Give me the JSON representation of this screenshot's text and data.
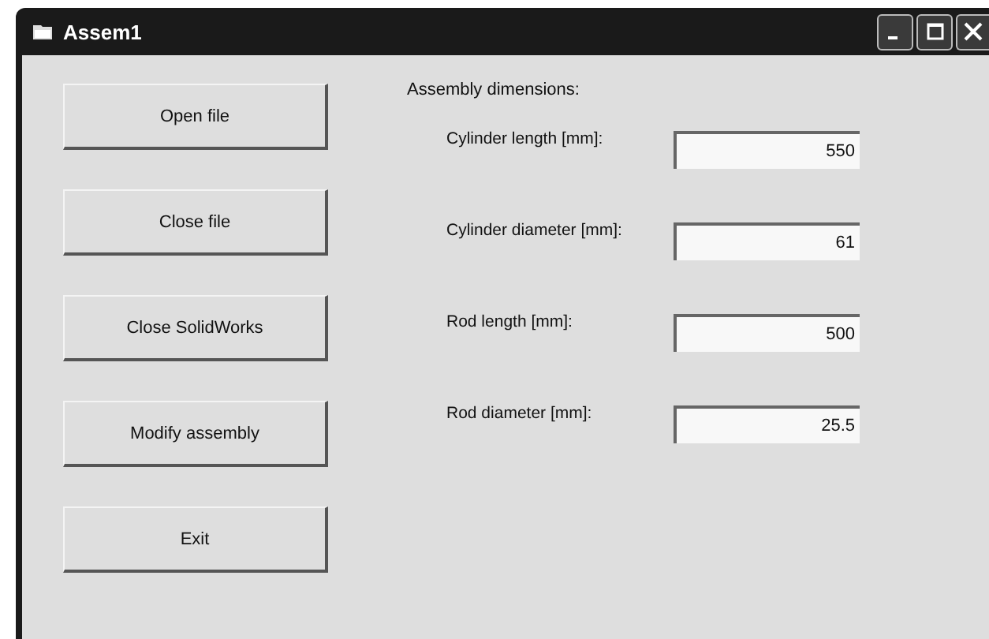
{
  "window": {
    "title": "Assem1"
  },
  "buttons": [
    "Open file",
    "Close file",
    "Close SolidWorks",
    "Modify assembly",
    "Exit"
  ],
  "section_label": "Assembly dimensions:",
  "fields": [
    {
      "label": "Cylinder length [mm]:",
      "value": "550"
    },
    {
      "label": "Cylinder diameter [mm]:",
      "value": "61"
    },
    {
      "label": "Rod length [mm]:",
      "value": "500"
    },
    {
      "label": "Rod diameter [mm]:",
      "value": "25.5"
    }
  ]
}
